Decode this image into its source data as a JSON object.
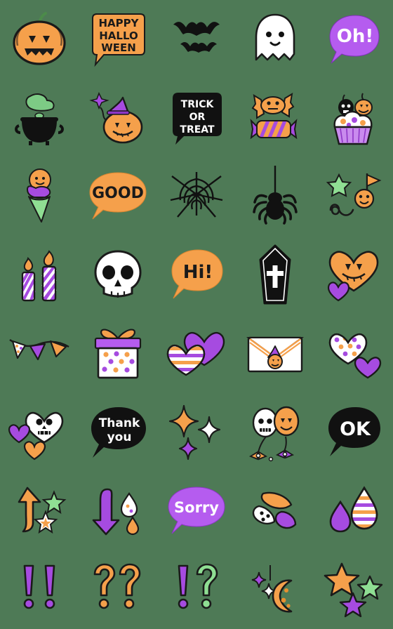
{
  "sheet": {
    "title": "Halloween Emoji Sticker Sheet",
    "background_color": "#4e7a56",
    "columns": 5,
    "rows": 8,
    "cell_size": 112,
    "palette": {
      "orange": "#F5A04B",
      "orange_dark": "#E8902F",
      "purple": "#A64BE0",
      "purple_light": "#B55CEF",
      "green": "#7DCB85",
      "black": "#111111",
      "white": "#FFFFFF",
      "cream": "#FFF6E8",
      "outline": "#1A1A1A"
    }
  },
  "stickers": [
    {
      "id": "jack-o-lantern",
      "row": 1,
      "col": 1,
      "name": "Jack-o'-lantern pumpkin",
      "label": ""
    },
    {
      "id": "happy-halloween-bubble",
      "row": 1,
      "col": 2,
      "name": "Happy Halloween speech bubble",
      "label": "HAPPY HALLO WEEN",
      "lines": [
        "HAPPY",
        "HALLO",
        "WEEN"
      ],
      "bubble_color": "#F5A04B",
      "text_color": "#1A1A1A"
    },
    {
      "id": "bats",
      "row": 1,
      "col": 3,
      "name": "Two flying bats",
      "label": ""
    },
    {
      "id": "ghost",
      "row": 1,
      "col": 4,
      "name": "White ghost",
      "label": ""
    },
    {
      "id": "oh-bubble",
      "row": 1,
      "col": 5,
      "name": "Oh! speech bubble",
      "label": "Oh!",
      "lines": [
        "Oh!"
      ],
      "bubble_color": "#B55CEF",
      "text_color": "#FFFFFF"
    },
    {
      "id": "cauldron",
      "row": 2,
      "col": 1,
      "name": "Witch cauldron with green potion",
      "label": ""
    },
    {
      "id": "witch-pumpkin",
      "row": 2,
      "col": 2,
      "name": "Pumpkin with witch hat and wand",
      "label": ""
    },
    {
      "id": "trick-or-treat-bubble",
      "row": 2,
      "col": 3,
      "name": "Trick or Treat speech bubble",
      "label": "TRICK OR TREAT",
      "lines": [
        "TRICK",
        "OR",
        "TREAT"
      ],
      "bubble_color": "#111111",
      "text_color": "#FFFFFF"
    },
    {
      "id": "candies",
      "row": 2,
      "col": 4,
      "name": "Two wrapped candies",
      "label": ""
    },
    {
      "id": "cupcake",
      "row": 2,
      "col": 5,
      "name": "Cupcake with skull and pumpkin",
      "label": ""
    },
    {
      "id": "ice-cream",
      "row": 3,
      "col": 1,
      "name": "Pumpkin ice cream cone",
      "label": ""
    },
    {
      "id": "good-bubble",
      "row": 3,
      "col": 2,
      "name": "GOOD speech bubble",
      "label": "GOOD",
      "lines": [
        "GOOD"
      ],
      "bubble_color": "#F5A04B",
      "text_color": "#1A1A1A"
    },
    {
      "id": "spider-web",
      "row": 3,
      "col": 3,
      "name": "Spider web",
      "label": ""
    },
    {
      "id": "spider",
      "row": 3,
      "col": 4,
      "name": "Hanging spider",
      "label": ""
    },
    {
      "id": "pumpkin-balloon-flag",
      "row": 3,
      "col": 5,
      "name": "Star, flag and pumpkin decoration",
      "label": ""
    },
    {
      "id": "candles",
      "row": 4,
      "col": 1,
      "name": "Two striped candles",
      "label": ""
    },
    {
      "id": "skull",
      "row": 4,
      "col": 2,
      "name": "White skull",
      "label": ""
    },
    {
      "id": "hi-bubble",
      "row": 4,
      "col": 3,
      "name": "Hi! speech bubble",
      "label": "Hi!",
      "lines": [
        "Hi!"
      ],
      "bubble_color": "#F5A04B",
      "text_color": "#1A1A1A"
    },
    {
      "id": "coffin",
      "row": 4,
      "col": 4,
      "name": "Coffin with cross",
      "label": ""
    },
    {
      "id": "pumpkin-heart",
      "row": 4,
      "col": 5,
      "name": "Pumpkin face heart with small heart",
      "label": ""
    },
    {
      "id": "bunting",
      "row": 5,
      "col": 1,
      "name": "Party bunting flags",
      "label": ""
    },
    {
      "id": "gift-box",
      "row": 5,
      "col": 2,
      "name": "Polka dot gift box",
      "label": ""
    },
    {
      "id": "striped-hearts",
      "row": 5,
      "col": 3,
      "name": "Striped heart and purple heart",
      "label": ""
    },
    {
      "id": "envelope",
      "row": 5,
      "col": 4,
      "name": "Envelope with witch pumpkin seal",
      "label": ""
    },
    {
      "id": "dotted-hearts",
      "row": 5,
      "col": 5,
      "name": "Polka dot heart and purple heart",
      "label": ""
    },
    {
      "id": "skull-hearts",
      "row": 6,
      "col": 1,
      "name": "Skull face heart with small hearts",
      "label": ""
    },
    {
      "id": "thank-you-bubble",
      "row": 6,
      "col": 2,
      "name": "Thank you speech bubble",
      "label": "Thank you",
      "lines": [
        "Thank",
        "you"
      ],
      "bubble_color": "#111111",
      "text_color": "#FFFFFF"
    },
    {
      "id": "sparkles",
      "row": 6,
      "col": 3,
      "name": "Sparkle stars",
      "label": ""
    },
    {
      "id": "balloons",
      "row": 6,
      "col": 4,
      "name": "Skull and pumpkin balloons",
      "label": ""
    },
    {
      "id": "ok-bubble",
      "row": 6,
      "col": 5,
      "name": "OK speech bubble",
      "label": "OK",
      "lines": [
        "OK"
      ],
      "bubble_color": "#111111",
      "text_color": "#FFFFFF"
    },
    {
      "id": "up-arrow",
      "row": 7,
      "col": 1,
      "name": "Orange up arrow with stars",
      "label": ""
    },
    {
      "id": "down-arrow",
      "row": 7,
      "col": 2,
      "name": "Purple down arrow with drops",
      "label": ""
    },
    {
      "id": "sorry-bubble",
      "row": 7,
      "col": 3,
      "name": "Sorry speech bubble",
      "label": "Sorry",
      "lines": [
        "Sorry"
      ],
      "bubble_color": "#B55CEF",
      "text_color": "#FFFFFF"
    },
    {
      "id": "petals",
      "row": 7,
      "col": 4,
      "name": "Three falling petals",
      "label": ""
    },
    {
      "id": "droplets",
      "row": 7,
      "col": 5,
      "name": "Purple and striped droplets",
      "label": ""
    },
    {
      "id": "double-exclamation",
      "row": 8,
      "col": 1,
      "name": "Double exclamation marks",
      "label": "!!",
      "mark_color": "#A64BE0"
    },
    {
      "id": "double-question",
      "row": 8,
      "col": 2,
      "name": "Double question marks",
      "label": "??",
      "mark_color": "#F5A04B"
    },
    {
      "id": "interrobang",
      "row": 8,
      "col": 3,
      "name": "Exclamation and question mark",
      "label": "!?",
      "mark_color_left": "#A64BE0",
      "mark_color_right": "#7DCB85"
    },
    {
      "id": "crescent-moon",
      "row": 8,
      "col": 4,
      "name": "Crescent moon with sparkles",
      "label": ""
    },
    {
      "id": "stars",
      "row": 8,
      "col": 5,
      "name": "Three colored stars",
      "label": ""
    }
  ]
}
